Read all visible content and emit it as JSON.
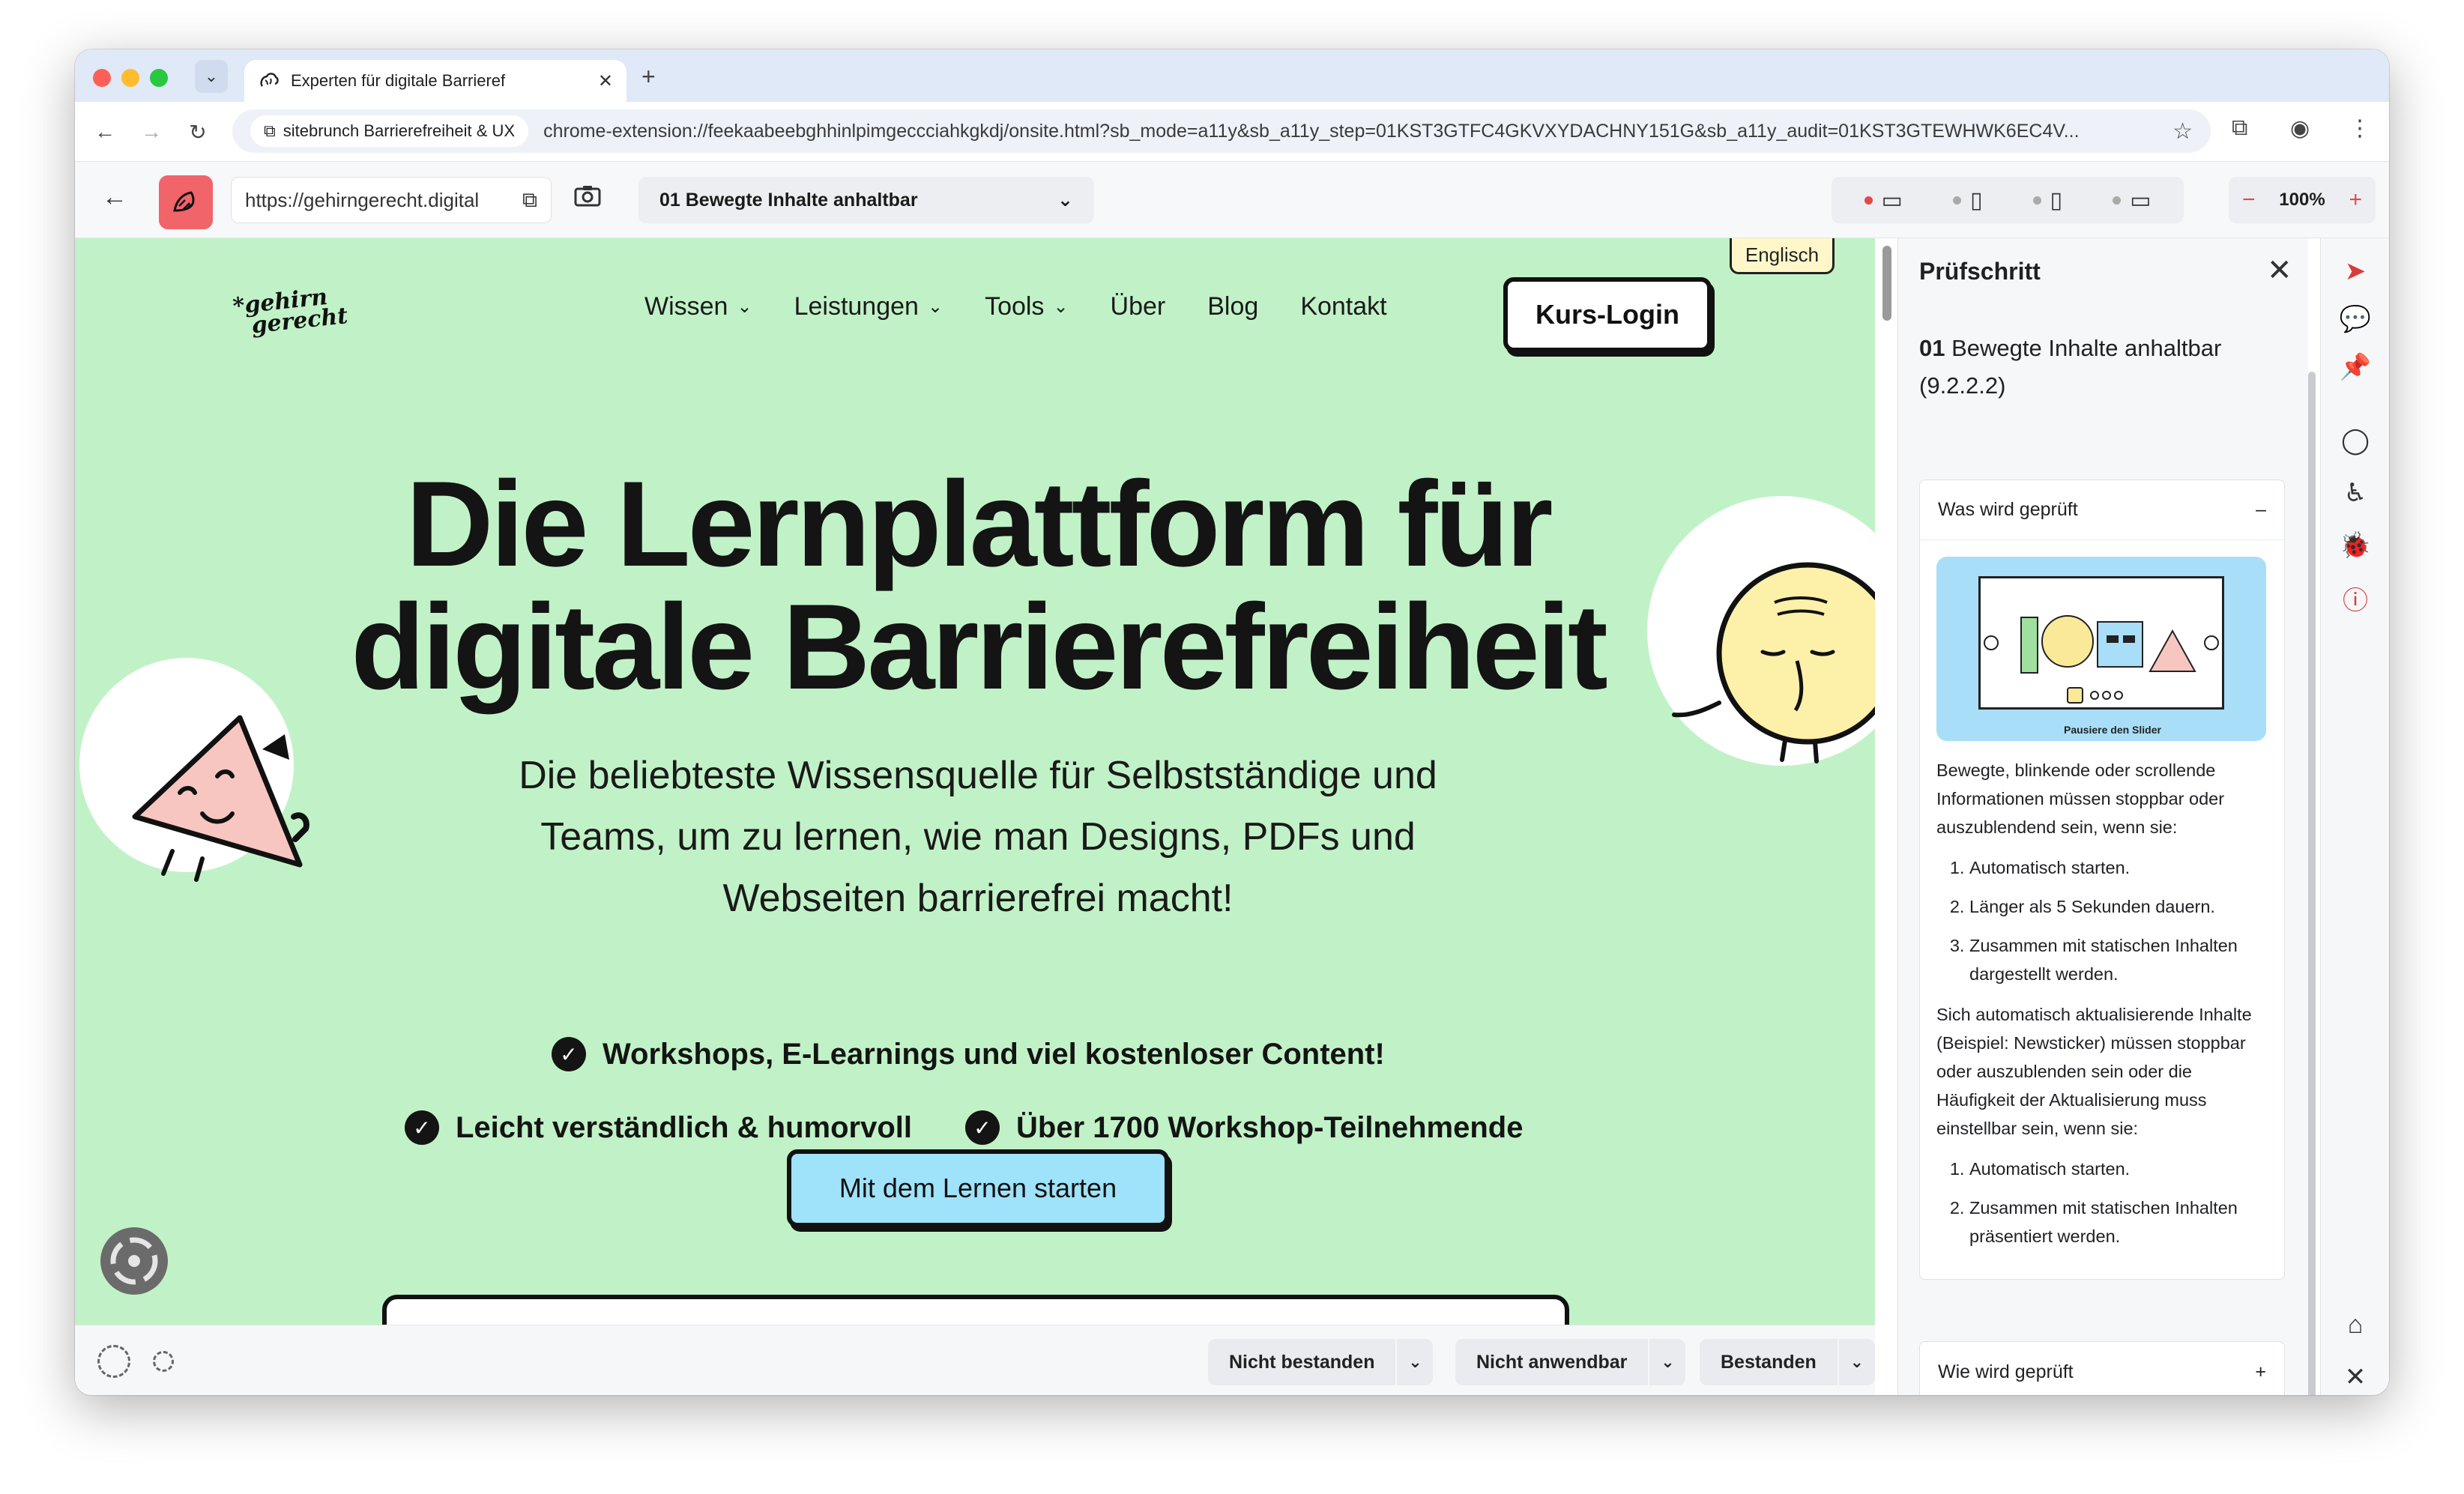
{
  "browser": {
    "tab_title": "Experten für digitale Barrieref",
    "site_chip": "sitebrunch Barrierefreiheit & UX",
    "url": "chrome-extension://feekaabeebghhinlpimgeccciahkgkdj/onsite.html?sb_mode=a11y&sb_a11y_step=01KST3GTFC4GKVXYDACHNY151G&sb_a11y_audit=01KST3GTEWHWK6EC4V..."
  },
  "extension": {
    "page_url": "https://gehirngerecht.digital",
    "step_select": "01 Bewegte Inhalte anhaltbar",
    "zoom": "100%"
  },
  "site": {
    "lang_badge": "Englisch",
    "logo_line1": "*gehirn",
    "logo_line2": "gerecht",
    "nav": [
      "Wissen",
      "Leistungen",
      "Tools",
      "Über",
      "Blog",
      "Kontakt"
    ],
    "login": "Kurs-Login",
    "title": "Die Lernplattform für digitale Barrierefreiheit",
    "subtitle": "Die beliebteste Wissensquelle für Selbstständige und Teams, um zu lernen, wie man Designs, PDFs und Webseiten barrierefrei macht!",
    "features": [
      "Workshops, E-Learnings und viel kostenloser Content!",
      "Leicht verständlich & humorvoll",
      "Über 1700 Workshop-Teilnehmende"
    ],
    "cta": "Mit dem Lernen starten"
  },
  "bottom": {
    "fail": "Nicht bestanden",
    "na": "Nicht anwendbar",
    "pass": "Bestanden"
  },
  "panel": {
    "heading": "Prüfschritt",
    "step_number": "01",
    "step_title": "Bewegte Inhalte anhaltbar",
    "step_ref": "(9.2.2.2)",
    "what_heading": "Was wird geprüft",
    "what_toggle": "–",
    "illu_caption": "Pausiere den Slider",
    "intro": "Bewegte, blinkende oder scrollende Informationen müssen stoppbar oder auszublendend sein, wenn sie:",
    "list1": [
      "Automatisch starten.",
      "Länger als 5 Sekunden dauern.",
      "Zusammen mit statischen Inhalten dargestellt werden."
    ],
    "para2": "Sich automatisch aktualisierende Inhalte (Beispiel: Newsticker) müssen stoppbar oder auszublenden sein oder die Häufigkeit der Aktualisierung muss einstellbar sein, wenn sie:",
    "list2": [
      "Automatisch starten.",
      "Zusammen mit statischen Inhalten präsentiert werden."
    ],
    "how_heading": "Wie wird geprüft",
    "how_toggle": "+"
  },
  "colors": {
    "site_bg": "#c1f2c7",
    "cta_bg": "#9fe3fa",
    "brand_red": "#f0646a",
    "active_dot": "#e04a4a"
  }
}
